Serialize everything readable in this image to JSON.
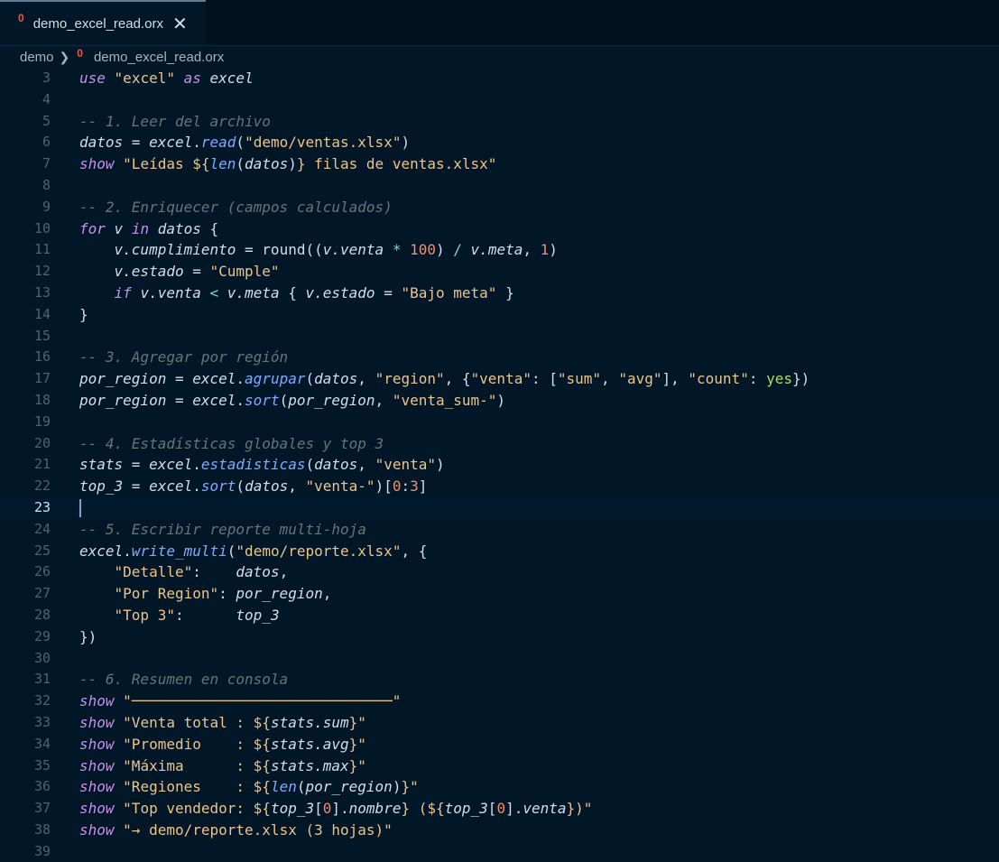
{
  "tab": {
    "title": "demo_excel_read.orx",
    "close": "✕",
    "icon": "0"
  },
  "breadcrumb": {
    "folder": "demo",
    "separator": "❯",
    "file": "demo_excel_read.orx",
    "icon": "0"
  },
  "editor": {
    "current_line": 23,
    "lines": [
      {
        "n": 3,
        "tokens": [
          [
            "kw",
            "use"
          ],
          [
            "plain",
            " "
          ],
          [
            "str",
            "\"excel\""
          ],
          [
            "plain",
            " "
          ],
          [
            "kw",
            "as"
          ],
          [
            "plain",
            " "
          ],
          [
            "var",
            "excel"
          ]
        ]
      },
      {
        "n": 4,
        "tokens": []
      },
      {
        "n": 5,
        "tokens": [
          [
            "cm",
            "-- 1. Leer del archivo"
          ]
        ]
      },
      {
        "n": 6,
        "tokens": [
          [
            "var",
            "datos"
          ],
          [
            "plain",
            " = "
          ],
          [
            "var",
            "excel"
          ],
          [
            "plain",
            "."
          ],
          [
            "fn",
            "read"
          ],
          [
            "plain",
            "("
          ],
          [
            "str",
            "\"demo/ventas.xlsx\""
          ],
          [
            "plain",
            ")"
          ]
        ]
      },
      {
        "n": 7,
        "tokens": [
          [
            "kw",
            "show"
          ],
          [
            "plain",
            " "
          ],
          [
            "str",
            "\"Leídas ${"
          ],
          [
            "fn",
            "len"
          ],
          [
            "plain",
            "("
          ],
          [
            "var",
            "datos"
          ],
          [
            "plain",
            ")"
          ],
          [
            "str",
            "} filas de ventas.xlsx\""
          ]
        ]
      },
      {
        "n": 8,
        "tokens": []
      },
      {
        "n": 9,
        "tokens": [
          [
            "cm",
            "-- 2. Enriquecer (campos calculados)"
          ]
        ]
      },
      {
        "n": 10,
        "tokens": [
          [
            "kw",
            "for"
          ],
          [
            "plain",
            " "
          ],
          [
            "var",
            "v"
          ],
          [
            "plain",
            " "
          ],
          [
            "kw",
            "in"
          ],
          [
            "plain",
            " "
          ],
          [
            "var",
            "datos"
          ],
          [
            "plain",
            " {"
          ]
        ]
      },
      {
        "n": 11,
        "tokens": [
          [
            "plain",
            "    "
          ],
          [
            "var",
            "v.cumplimiento"
          ],
          [
            "plain",
            " = "
          ],
          [
            "plain",
            "round"
          ],
          [
            "plain",
            "(("
          ],
          [
            "var",
            "v.venta"
          ],
          [
            "plain",
            " "
          ],
          [
            "op",
            "*"
          ],
          [
            "plain",
            " "
          ],
          [
            "num",
            "100"
          ],
          [
            "plain",
            ") "
          ],
          [
            "op",
            "/"
          ],
          [
            "plain",
            " "
          ],
          [
            "var",
            "v.meta"
          ],
          [
            "plain",
            ", "
          ],
          [
            "num",
            "1"
          ],
          [
            "plain",
            ")"
          ]
        ]
      },
      {
        "n": 12,
        "tokens": [
          [
            "plain",
            "    "
          ],
          [
            "var",
            "v.estado"
          ],
          [
            "plain",
            " = "
          ],
          [
            "str",
            "\"Cumple\""
          ]
        ]
      },
      {
        "n": 13,
        "tokens": [
          [
            "plain",
            "    "
          ],
          [
            "kw",
            "if"
          ],
          [
            "plain",
            " "
          ],
          [
            "var",
            "v.venta"
          ],
          [
            "plain",
            " "
          ],
          [
            "op",
            "<"
          ],
          [
            "plain",
            " "
          ],
          [
            "var",
            "v.meta"
          ],
          [
            "plain",
            " { "
          ],
          [
            "var",
            "v.estado"
          ],
          [
            "plain",
            " = "
          ],
          [
            "str",
            "\"Bajo meta\""
          ],
          [
            "plain",
            " }"
          ]
        ]
      },
      {
        "n": 14,
        "tokens": [
          [
            "plain",
            "}"
          ]
        ]
      },
      {
        "n": 15,
        "tokens": []
      },
      {
        "n": 16,
        "tokens": [
          [
            "cm",
            "-- 3. Agregar por región"
          ]
        ]
      },
      {
        "n": 17,
        "tokens": [
          [
            "var",
            "por_region"
          ],
          [
            "plain",
            " = "
          ],
          [
            "var",
            "excel"
          ],
          [
            "plain",
            "."
          ],
          [
            "fn",
            "agrupar"
          ],
          [
            "plain",
            "("
          ],
          [
            "var",
            "datos"
          ],
          [
            "plain",
            ", "
          ],
          [
            "str",
            "\"region\""
          ],
          [
            "plain",
            ", {"
          ],
          [
            "str",
            "\"venta\""
          ],
          [
            "plain",
            ": ["
          ],
          [
            "str",
            "\"sum\""
          ],
          [
            "plain",
            ", "
          ],
          [
            "str",
            "\"avg\""
          ],
          [
            "plain",
            "], "
          ],
          [
            "str",
            "\"count\""
          ],
          [
            "plain",
            ": "
          ],
          [
            "str2",
            "yes"
          ],
          [
            "plain",
            "})"
          ]
        ]
      },
      {
        "n": 18,
        "tokens": [
          [
            "var",
            "por_region"
          ],
          [
            "plain",
            " = "
          ],
          [
            "var",
            "excel"
          ],
          [
            "plain",
            "."
          ],
          [
            "fn",
            "sort"
          ],
          [
            "plain",
            "("
          ],
          [
            "var",
            "por_region"
          ],
          [
            "plain",
            ", "
          ],
          [
            "str",
            "\"venta_sum-\""
          ],
          [
            "plain",
            ")"
          ]
        ]
      },
      {
        "n": 19,
        "tokens": []
      },
      {
        "n": 20,
        "tokens": [
          [
            "cm",
            "-- 4. Estadísticas globales y top 3"
          ]
        ]
      },
      {
        "n": 21,
        "tokens": [
          [
            "var",
            "stats"
          ],
          [
            "plain",
            " = "
          ],
          [
            "var",
            "excel"
          ],
          [
            "plain",
            "."
          ],
          [
            "fn",
            "estadisticas"
          ],
          [
            "plain",
            "("
          ],
          [
            "var",
            "datos"
          ],
          [
            "plain",
            ", "
          ],
          [
            "str",
            "\"venta\""
          ],
          [
            "plain",
            ")"
          ]
        ]
      },
      {
        "n": 22,
        "tokens": [
          [
            "var",
            "top_3"
          ],
          [
            "plain",
            " = "
          ],
          [
            "var",
            "excel"
          ],
          [
            "plain",
            "."
          ],
          [
            "fn",
            "sort"
          ],
          [
            "plain",
            "("
          ],
          [
            "var",
            "datos"
          ],
          [
            "plain",
            ", "
          ],
          [
            "str",
            "\"venta-\""
          ],
          [
            "plain",
            ")["
          ],
          [
            "num",
            "0"
          ],
          [
            "plain",
            ":"
          ],
          [
            "num",
            "3"
          ],
          [
            "plain",
            "]"
          ]
        ]
      },
      {
        "n": 23,
        "tokens": []
      },
      {
        "n": 24,
        "tokens": [
          [
            "cm",
            "-- 5. Escribir reporte multi-hoja"
          ]
        ]
      },
      {
        "n": 25,
        "tokens": [
          [
            "var",
            "excel"
          ],
          [
            "plain",
            "."
          ],
          [
            "fn",
            "write_multi"
          ],
          [
            "plain",
            "("
          ],
          [
            "str",
            "\"demo/reporte.xlsx\""
          ],
          [
            "plain",
            ", {"
          ]
        ]
      },
      {
        "n": 26,
        "tokens": [
          [
            "plain",
            "    "
          ],
          [
            "str",
            "\"Detalle\""
          ],
          [
            "plain",
            ":    "
          ],
          [
            "var",
            "datos"
          ],
          [
            "plain",
            ","
          ]
        ]
      },
      {
        "n": 27,
        "tokens": [
          [
            "plain",
            "    "
          ],
          [
            "str",
            "\"Por Region\""
          ],
          [
            "plain",
            ": "
          ],
          [
            "var",
            "por_region"
          ],
          [
            "plain",
            ","
          ]
        ]
      },
      {
        "n": 28,
        "tokens": [
          [
            "plain",
            "    "
          ],
          [
            "str",
            "\"Top 3\""
          ],
          [
            "plain",
            ":      "
          ],
          [
            "var",
            "top_3"
          ]
        ]
      },
      {
        "n": 29,
        "tokens": [
          [
            "plain",
            "})"
          ]
        ]
      },
      {
        "n": 30,
        "tokens": []
      },
      {
        "n": 31,
        "tokens": [
          [
            "cm",
            "-- 6. Resumen en consola"
          ]
        ]
      },
      {
        "n": 32,
        "tokens": [
          [
            "kw",
            "show"
          ],
          [
            "plain",
            " "
          ],
          [
            "str",
            "\"──────────────────────────────\""
          ]
        ]
      },
      {
        "n": 33,
        "tokens": [
          [
            "kw",
            "show"
          ],
          [
            "plain",
            " "
          ],
          [
            "str",
            "\"Venta total : ${"
          ],
          [
            "var",
            "stats.sum"
          ],
          [
            "str",
            "}\""
          ]
        ]
      },
      {
        "n": 34,
        "tokens": [
          [
            "kw",
            "show"
          ],
          [
            "plain",
            " "
          ],
          [
            "str",
            "\"Promedio    : ${"
          ],
          [
            "var",
            "stats.avg"
          ],
          [
            "str",
            "}\""
          ]
        ]
      },
      {
        "n": 35,
        "tokens": [
          [
            "kw",
            "show"
          ],
          [
            "plain",
            " "
          ],
          [
            "str",
            "\"Máxima      : ${"
          ],
          [
            "var",
            "stats.max"
          ],
          [
            "str",
            "}\""
          ]
        ]
      },
      {
        "n": 36,
        "tokens": [
          [
            "kw",
            "show"
          ],
          [
            "plain",
            " "
          ],
          [
            "str",
            "\"Regiones    : ${"
          ],
          [
            "fn",
            "len"
          ],
          [
            "plain",
            "("
          ],
          [
            "var",
            "por_region"
          ],
          [
            "plain",
            ")"
          ],
          [
            "str",
            "}\""
          ]
        ]
      },
      {
        "n": 37,
        "tokens": [
          [
            "kw",
            "show"
          ],
          [
            "plain",
            " "
          ],
          [
            "str",
            "\"Top vendedor: ${"
          ],
          [
            "var",
            "top_3"
          ],
          [
            "plain",
            "["
          ],
          [
            "num",
            "0"
          ],
          [
            "plain",
            "]."
          ],
          [
            "var",
            "nombre"
          ],
          [
            "str",
            "} (${"
          ],
          [
            "var",
            "top_3"
          ],
          [
            "plain",
            "["
          ],
          [
            "num",
            "0"
          ],
          [
            "plain",
            "]."
          ],
          [
            "var",
            "venta"
          ],
          [
            "str",
            "})\""
          ]
        ]
      },
      {
        "n": 38,
        "tokens": [
          [
            "kw",
            "show"
          ],
          [
            "plain",
            " "
          ],
          [
            "str",
            "\"→ demo/reporte.xlsx (3 hojas)\""
          ]
        ]
      },
      {
        "n": 39,
        "tokens": []
      }
    ]
  }
}
